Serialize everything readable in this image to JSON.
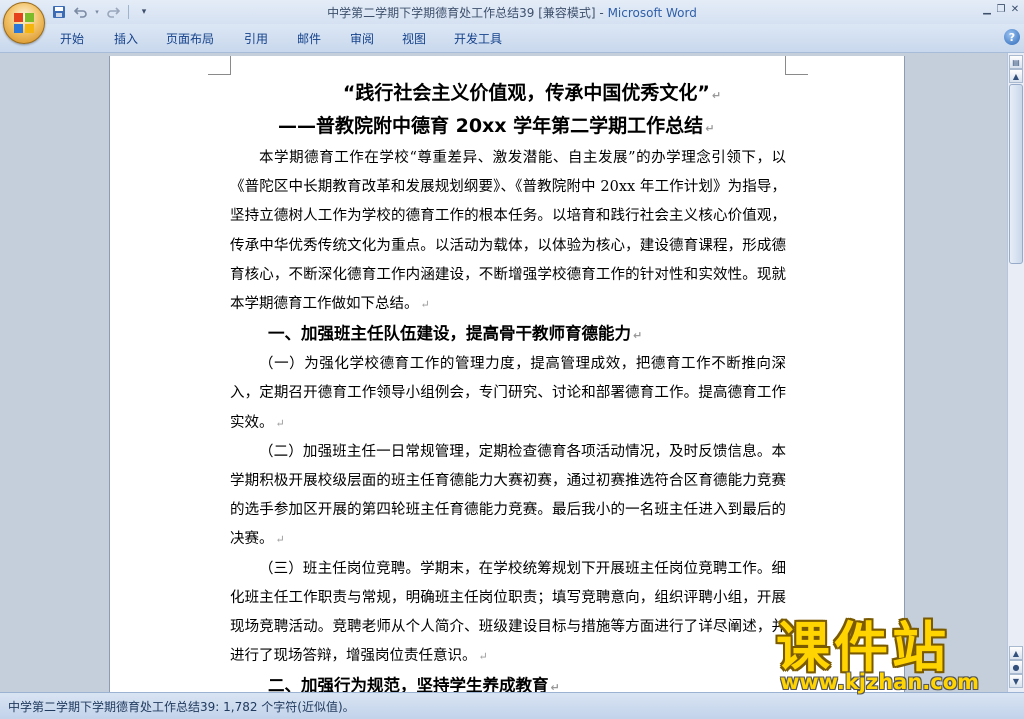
{
  "window": {
    "title_doc": "中学第二学期下学期德育处工作总结39 [兼容模式] - ",
    "title_app": "Microsoft Word"
  },
  "ribbon": {
    "tabs": [
      "开始",
      "插入",
      "页面布局",
      "引用",
      "邮件",
      "审阅",
      "视图",
      "开发工具"
    ]
  },
  "document": {
    "title_line1": "“践行社会主义价值观，传承中国优秀文化”",
    "title_line2": "——普教院附中德育 20xx 学年第二学期工作总结",
    "para_intro": "本学期德育工作在学校“尊重差异、激发潜能、自主发展”的办学理念引领下，以《普陀区中长期教育改革和发展规划纲要》、《普教院附中 20xx 年工作计划》为指导，坚持立德树人工作为学校的德育工作的根本任务。以培育和践行社会主义核心价值观，传承中华优秀传统文化为重点。以活动为载体，以体验为核心，建设德育课程，形成德育核心，不断深化德育工作内涵建设，不断增强学校德育工作的针对性和实效性。现就本学期德育工作做如下总结。",
    "heading1": "一、加强班主任队伍建设，提高骨干教师育德能力",
    "para_1": "（一）为强化学校德育工作的管理力度，提高管理成效，把德育工作不断推向深入，定期召开德育工作领导小组例会，专门研究、讨论和部署德育工作。提高德育工作实效。",
    "para_2": "（二）加强班主任一日常规管理，定期检查德育各项活动情况，及时反馈信息。本学期积极开展校级层面的班主任育德能力大赛初赛，通过初赛推选符合区育德能力竞赛的选手参加区开展的第四轮班主任育德能力竞赛。最后我小的一名班主任进入到最后的决赛。",
    "para_3": "（三）班主任岗位竞聘。学期末，在学校统筹规划下开展班主任岗位竞聘工作。细化班主任工作职责与常规，明确班主任岗位职责；填写竞聘意向，组织评聘小组，开展现场竞聘活动。竞聘老师从个人简介、班级建设目标与措施等方面进行了详尽阐述，并进行了现场答辩，增强岗位责任意识。",
    "heading2": "二、加强行为规范，坚持学生养成教育",
    "paragraph_mark": "↵"
  },
  "status_bar": {
    "text": "中学第二学期下学期德育处工作总结39: 1,782 个字符(近似值)。"
  },
  "watermark": {
    "title": "课件站",
    "url": "www.kjzhan.com"
  },
  "icons": [
    "office-button-icon",
    "save-icon",
    "undo-icon",
    "redo-icon",
    "customize-qat-icon",
    "minimize-icon",
    "restore-icon",
    "close-icon",
    "help-icon",
    "scroll-up-icon",
    "scroll-down-icon",
    "ruler-toggle-icon"
  ]
}
